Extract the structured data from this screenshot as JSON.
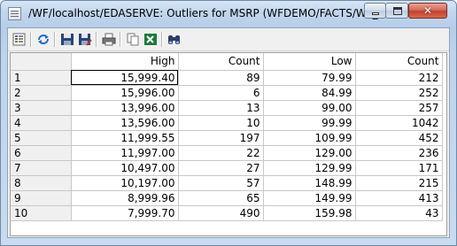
{
  "window": {
    "title": "/WF/localhost/EDASERVE: Outliers for MSRP (WFDEMO/FACTS/WF_..."
  },
  "toolbar": {
    "buttons": [
      "properties-icon",
      "refresh-icon",
      "save-icon",
      "save-as-icon",
      "print-icon",
      "copy-icon",
      "excel-icon",
      "find-icon"
    ]
  },
  "grid": {
    "columns": [
      "",
      "High",
      "Count",
      "Low",
      "Count"
    ],
    "rows": [
      {
        "row": "1",
        "high": "15,999.40",
        "high_count": "89",
        "low": "79.99",
        "low_count": "212"
      },
      {
        "row": "2",
        "high": "15,996.00",
        "high_count": "6",
        "low": "84.99",
        "low_count": "252"
      },
      {
        "row": "3",
        "high": "13,996.00",
        "high_count": "13",
        "low": "99.00",
        "low_count": "257"
      },
      {
        "row": "4",
        "high": "13,596.00",
        "high_count": "10",
        "low": "99.99",
        "low_count": "1042"
      },
      {
        "row": "5",
        "high": "11,999.55",
        "high_count": "197",
        "low": "109.99",
        "low_count": "452"
      },
      {
        "row": "6",
        "high": "11,997.00",
        "high_count": "22",
        "low": "129.00",
        "low_count": "236"
      },
      {
        "row": "7",
        "high": "10,497.00",
        "high_count": "27",
        "low": "129.99",
        "low_count": "171"
      },
      {
        "row": "8",
        "high": "10,197.00",
        "high_count": "57",
        "low": "148.99",
        "low_count": "215"
      },
      {
        "row": "9",
        "high": "8,999.96",
        "high_count": "65",
        "low": "149.99",
        "low_count": "413"
      },
      {
        "row": "10",
        "high": "7,999.70",
        "high_count": "490",
        "low": "159.98",
        "low_count": "43"
      }
    ]
  }
}
